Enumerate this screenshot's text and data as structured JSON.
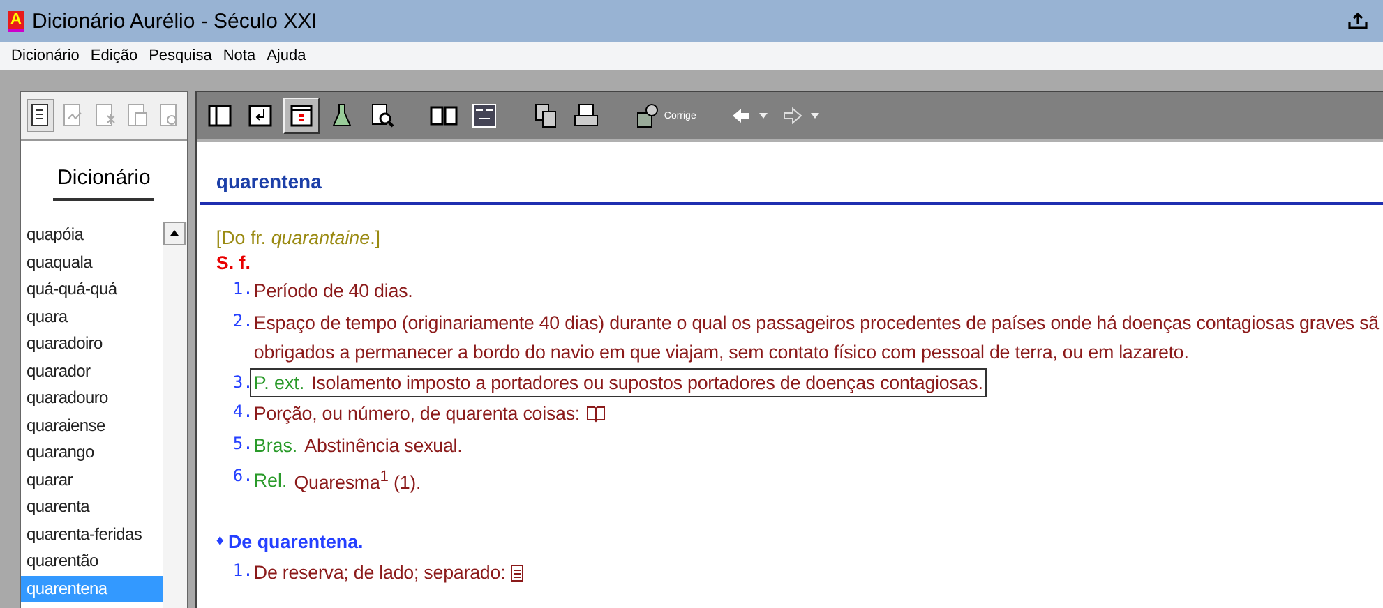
{
  "window": {
    "title": "Dicionário Aurélio - Século XXI",
    "logo_letter": "A"
  },
  "menu": [
    "Dicionário",
    "Edição",
    "Pesquisa",
    "Nota",
    "Ajuda"
  ],
  "left_toolbar": [
    {
      "kind": "page",
      "disabled": false
    },
    {
      "kind": "sign",
      "disabled": true
    },
    {
      "kind": "star",
      "disabled": true
    },
    {
      "kind": "pages",
      "disabled": true
    },
    {
      "kind": "find",
      "disabled": true
    }
  ],
  "right_toolbar": [
    {
      "kind": "panel",
      "pressed": false
    },
    {
      "kind": "swap",
      "pressed": false
    },
    {
      "kind": "mark",
      "pressed": true
    },
    {
      "kind": "flask",
      "pressed": false
    },
    {
      "kind": "find",
      "pressed": false
    },
    {
      "kind": "gap"
    },
    {
      "kind": "book",
      "pressed": false
    },
    {
      "kind": "conjugate",
      "pressed": false
    },
    {
      "kind": "gap"
    },
    {
      "kind": "copy",
      "pressed": false
    },
    {
      "kind": "print",
      "pressed": false
    },
    {
      "kind": "gap"
    },
    {
      "kind": "corrector",
      "pressed": false,
      "label": "Corrige"
    },
    {
      "kind": "gap"
    },
    {
      "kind": "back"
    },
    {
      "kind": "forward"
    }
  ],
  "sidebar": {
    "title": "Dicionário",
    "items": [
      {
        "label": "quapóia",
        "selected": false
      },
      {
        "label": "quaquala",
        "selected": false
      },
      {
        "label": "quá-quá-quá",
        "selected": false
      },
      {
        "label": "quara",
        "selected": false
      },
      {
        "label": "quaradoiro",
        "selected": false
      },
      {
        "label": "quarador",
        "selected": false
      },
      {
        "label": "quaradouro",
        "selected": false
      },
      {
        "label": "quaraiense",
        "selected": false
      },
      {
        "label": "quarango",
        "selected": false
      },
      {
        "label": "quarar",
        "selected": false
      },
      {
        "label": "quarenta",
        "selected": false
      },
      {
        "label": "quarenta-feridas",
        "selected": false
      },
      {
        "label": "quarentão",
        "selected": false
      },
      {
        "label": "quarentena",
        "selected": true
      }
    ]
  },
  "entry": {
    "headword": "quarentena",
    "etymology": "[Do fr. *quarantaine*.]",
    "word_class": "S. f.",
    "senses": [
      {
        "number": "1.",
        "lines": [
          "Período de 40 dias."
        ],
        "kind": "plain",
        "selected": false
      },
      {
        "number": "2.",
        "lines": [
          "Espaço de tempo (originariamente 40 dias) durante o qual os passageiros procedentes de países onde há doenças contagiosas graves sã",
          "obrigados a permanecer a bordo do navio em que viajam, sem contato físico com pessoal de terra, ou em lazareto."
        ],
        "kind": "plain",
        "selected": false
      },
      {
        "number": "3.",
        "label": "P. ext.",
        "lines": [
          "Isolamento imposto a portadores ou supostos portadores de doenças contagiosas."
        ],
        "kind": "plain",
        "selected": true
      },
      {
        "number": "4.",
        "lines": [
          "Porção, ou número, de quarenta coisas:"
        ],
        "kind": "book",
        "selected": false
      },
      {
        "number": "5.",
        "label": "Bras.",
        "lines": [
          "Abstinência sexual."
        ],
        "kind": "plain",
        "selected": false
      },
      {
        "number": "6.",
        "label": "Rel.",
        "lines": [
          "Quaresma$^{1}$ (1)."
        ],
        "kind": "plain",
        "selected": false
      }
    ],
    "expressions": [
      {
        "bullet": "♦",
        "title": "De quarentena.",
        "senses": [
          {
            "number": "1.",
            "lines": [
              "De reserva; de lado; separado:"
            ],
            "kind": "document",
            "selected": false
          }
        ]
      }
    ]
  }
}
